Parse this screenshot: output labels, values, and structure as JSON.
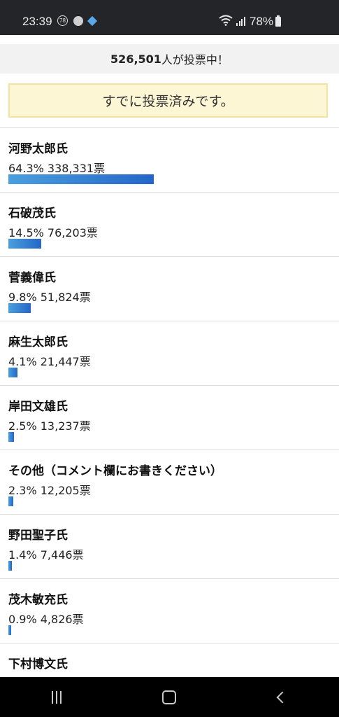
{
  "status_bar": {
    "time": "23:39",
    "notification_badge": "78",
    "battery_percent": "78%"
  },
  "vote_count": {
    "number": "526,501",
    "suffix": "人が投票中！"
  },
  "voted_message": "すでに投票済みです。",
  "results": [
    {
      "name": "河野太郎氏",
      "percent": "64.3%",
      "votes": "338,331票",
      "share": 64.3
    },
    {
      "name": "石破茂氏",
      "percent": "14.5%",
      "votes": "76,203票",
      "share": 14.5
    },
    {
      "name": "菅義偉氏",
      "percent": "9.8%",
      "votes": "51,824票",
      "share": 9.8
    },
    {
      "name": "麻生太郎氏",
      "percent": "4.1%",
      "votes": "21,447票",
      "share": 4.1
    },
    {
      "name": "岸田文雄氏",
      "percent": "2.5%",
      "votes": "13,237票",
      "share": 2.5
    },
    {
      "name": "その他（コメント欄にお書きください）",
      "percent": "2.3%",
      "votes": "12,205票",
      "share": 2.3
    },
    {
      "name": "野田聖子氏",
      "percent": "1.4%",
      "votes": "7,446票",
      "share": 1.4
    },
    {
      "name": "茂木敏充氏",
      "percent": "0.9%",
      "votes": "4,826票",
      "share": 0.9
    },
    {
      "name": "下村博文氏",
      "percent": "",
      "votes": "",
      "share": null
    }
  ],
  "colors": {
    "bar_start": "#4a9fdc",
    "bar_end": "#2466c8",
    "notice_bg": "#fcf6d4",
    "notice_border": "#f1e4a0"
  }
}
